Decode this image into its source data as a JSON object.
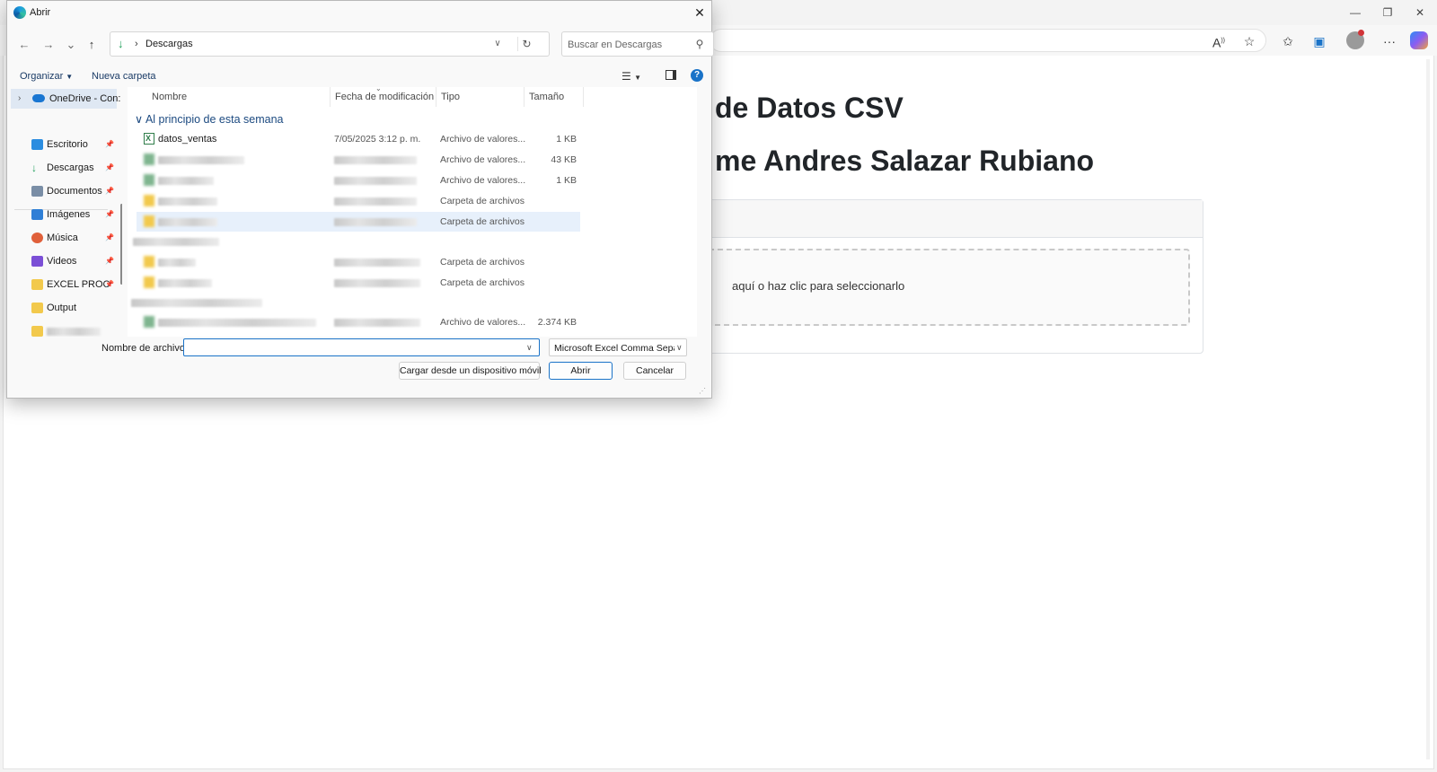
{
  "browser": {
    "window_controls": {
      "minimize": "—",
      "restore": "❐",
      "close": "✕"
    },
    "page": {
      "title": "de Datos CSV",
      "author": "me Andres Salazar Rubiano",
      "dropzone_text": "aquí o haz clic para seleccionarlo"
    }
  },
  "dialog": {
    "title": "Abrir",
    "nav": {
      "back": "←",
      "forward": "→",
      "recent": "⌄",
      "up": "↑"
    },
    "path": {
      "separator": "›",
      "current": "Descargas"
    },
    "search": {
      "placeholder": "Buscar en Descargas"
    },
    "commands": {
      "organize": "Organizar",
      "new_folder": "Nueva carpeta"
    },
    "nav_pane": {
      "onedrive": "OneDrive - Con:",
      "items": [
        {
          "label": "Escritorio",
          "icon": "desktop-icon",
          "color": "#2b8de0"
        },
        {
          "label": "Descargas",
          "icon": "download-icon",
          "color": "#1e9e5a"
        },
        {
          "label": "Documentos",
          "icon": "documents-icon",
          "color": "#7a8ea6"
        },
        {
          "label": "Imágenes",
          "icon": "pictures-icon",
          "color": "#2f7fd6"
        },
        {
          "label": "Música",
          "icon": "music-icon",
          "color": "#e0603a"
        },
        {
          "label": "Videos",
          "icon": "videos-icon",
          "color": "#7b4fd6"
        },
        {
          "label": "EXCEL PROC",
          "icon": "folder-icon",
          "color": "#f2c94c"
        },
        {
          "label": "Output",
          "icon": "folder-icon",
          "color": "#f2c94c"
        }
      ]
    },
    "columns": {
      "name": "Nombre",
      "date": "Fecha de modificación",
      "type": "Tipo",
      "size": "Tamaño"
    },
    "group": "Al principio de esta semana",
    "files": [
      {
        "name": "datos_ventas",
        "date": "7/05/2025 3:12 p. m.",
        "type": "Archivo de valores...",
        "size": "1 KB"
      },
      {
        "name": "",
        "date": "",
        "type": "Archivo de valores...",
        "size": "43 KB"
      },
      {
        "name": "",
        "date": "",
        "type": "Archivo de valores...",
        "size": "1 KB"
      },
      {
        "name": "",
        "date": "",
        "type": "Carpeta de archivos",
        "size": ""
      },
      {
        "name": "",
        "date": "",
        "type": "Carpeta de archivos",
        "size": ""
      },
      {
        "name": "",
        "date": "",
        "type": "",
        "size": ""
      },
      {
        "name": "",
        "date": "",
        "type": "Carpeta de archivos",
        "size": ""
      },
      {
        "name": "",
        "date": "",
        "type": "Carpeta de archivos",
        "size": ""
      },
      {
        "name": "",
        "date": "",
        "type": "",
        "size": ""
      },
      {
        "name": "",
        "date": "",
        "type": "Archivo de valores...",
        "size": "2.374 KB"
      }
    ],
    "filename": {
      "label": "Nombre de archivo:",
      "value": ""
    },
    "filetype": "Microsoft Excel Comma Separa",
    "buttons": {
      "mobile": "Cargar desde un dispositivo móvil",
      "open": "Abrir",
      "cancel": "Cancelar"
    },
    "accent": "#1a73c8"
  }
}
